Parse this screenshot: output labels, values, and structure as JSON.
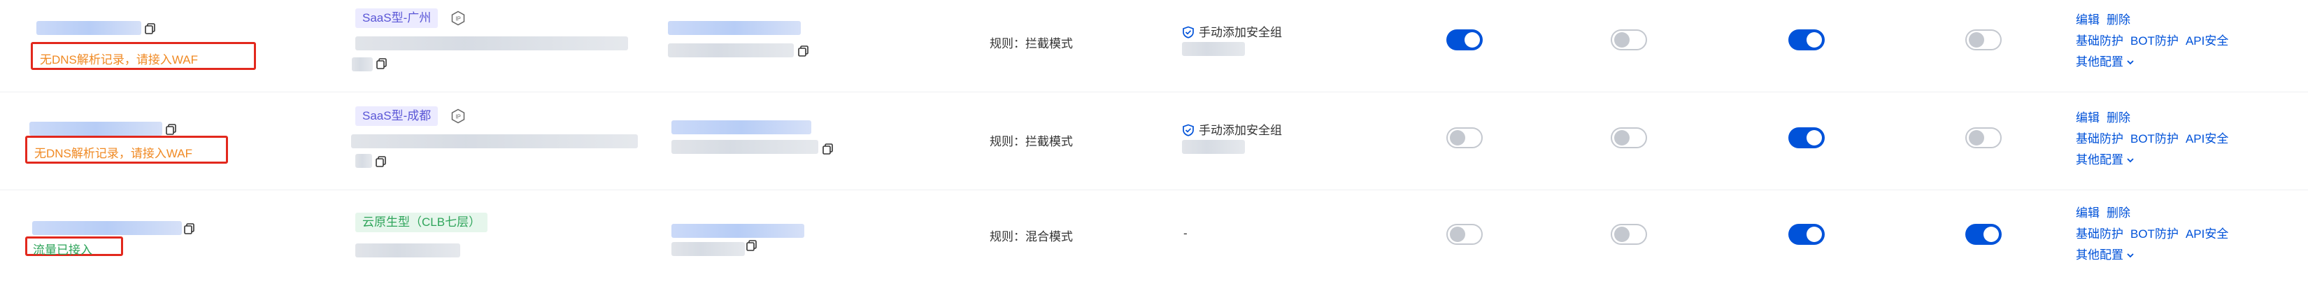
{
  "rows": [
    {
      "alert": "无DNS解析记录，请接入WAF",
      "tag": "SaaS型-广州",
      "rule": "规则：拦截模式",
      "security_group": "手动添加安全组",
      "toggles": [
        true,
        false,
        true,
        false
      ],
      "ops": {
        "edit": "编辑",
        "delete": "删除",
        "basic": "基础防护",
        "bot": "BOT防护",
        "api": "API安全",
        "more": "其他配置"
      }
    },
    {
      "alert": "无DNS解析记录，请接入WAF",
      "tag": "SaaS型-成都",
      "rule": "规则：拦截模式",
      "security_group": "手动添加安全组",
      "toggles": [
        false,
        false,
        true,
        false
      ],
      "ops": {
        "edit": "编辑",
        "delete": "删除",
        "basic": "基础防护",
        "bot": "BOT防护",
        "api": "API安全",
        "more": "其他配置"
      }
    },
    {
      "alert": "流量已接入",
      "tag": "云原生型（CLB七层）",
      "rule": "规则：混合模式",
      "security_group": "-",
      "toggles": [
        false,
        false,
        true,
        true
      ],
      "ops": {
        "edit": "编辑",
        "delete": "删除",
        "basic": "基础防护",
        "bot": "BOT防护",
        "api": "API安全",
        "more": "其他配置"
      }
    }
  ],
  "colors": {
    "accent": "#0052d9",
    "alert_border": "#e2281d",
    "warn_text": "#f08a24",
    "ok_text": "#2ea45a"
  },
  "icons": {
    "copy": "copy-icon",
    "ip": "ip-icon",
    "shield": "shield-icon",
    "chevron": "chevron-down-icon"
  }
}
